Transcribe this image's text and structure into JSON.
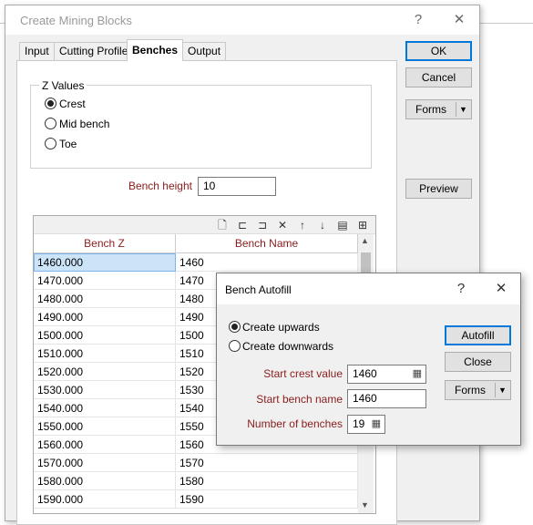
{
  "main": {
    "title": "Create Mining Blocks",
    "help": "?",
    "close": "✕",
    "tabs": [
      "Input",
      "Cutting Profile",
      "Benches",
      "Output"
    ],
    "active_tab": "Benches",
    "z_values": {
      "legend": "Z Values",
      "options": [
        "Crest",
        "Mid bench",
        "Toe"
      ],
      "selected": "Crest"
    },
    "bench_height_label": "Bench height",
    "bench_height_value": "10",
    "grid": {
      "columns": [
        "Bench Z",
        "Bench Name"
      ],
      "rows": [
        [
          "1460.000",
          "1460"
        ],
        [
          "1470.000",
          "1470"
        ],
        [
          "1480.000",
          "1480"
        ],
        [
          "1490.000",
          "1490"
        ],
        [
          "1500.000",
          "1500"
        ],
        [
          "1510.000",
          "1510"
        ],
        [
          "1520.000",
          "1520"
        ],
        [
          "1530.000",
          "1530"
        ],
        [
          "1540.000",
          "1540"
        ],
        [
          "1550.000",
          "1550"
        ],
        [
          "1560.000",
          "1560"
        ],
        [
          "1570.000",
          "1570"
        ],
        [
          "1580.000",
          "1580"
        ],
        [
          "1590.000",
          "1590"
        ]
      ],
      "toolbar_icons": [
        "new-row-icon",
        "insert-row-icon",
        "insert-after-icon",
        "delete-row-icon",
        "move-up-icon",
        "move-down-icon",
        "table-view-icon",
        "add-columns-icon"
      ]
    },
    "buttons": {
      "ok": "OK",
      "cancel": "Cancel",
      "forms": "Forms",
      "preview": "Preview"
    }
  },
  "autofill": {
    "title": "Bench Autofill",
    "help": "?",
    "close": "✕",
    "direction_options": [
      "Create upwards",
      "Create downwards"
    ],
    "direction_selected": "Create upwards",
    "start_crest_label": "Start crest value",
    "start_crest_value": "1460",
    "start_bench_label": "Start bench name",
    "start_bench_value": "1460",
    "num_benches_label": "Number of benches",
    "num_benches_value": "19",
    "buttons": {
      "autofill": "Autofill",
      "close": "Close",
      "forms": "Forms"
    }
  },
  "colors": {
    "label_red": "#8b1c1c",
    "accent": "#0078d7",
    "selection": "#cce4f7"
  }
}
